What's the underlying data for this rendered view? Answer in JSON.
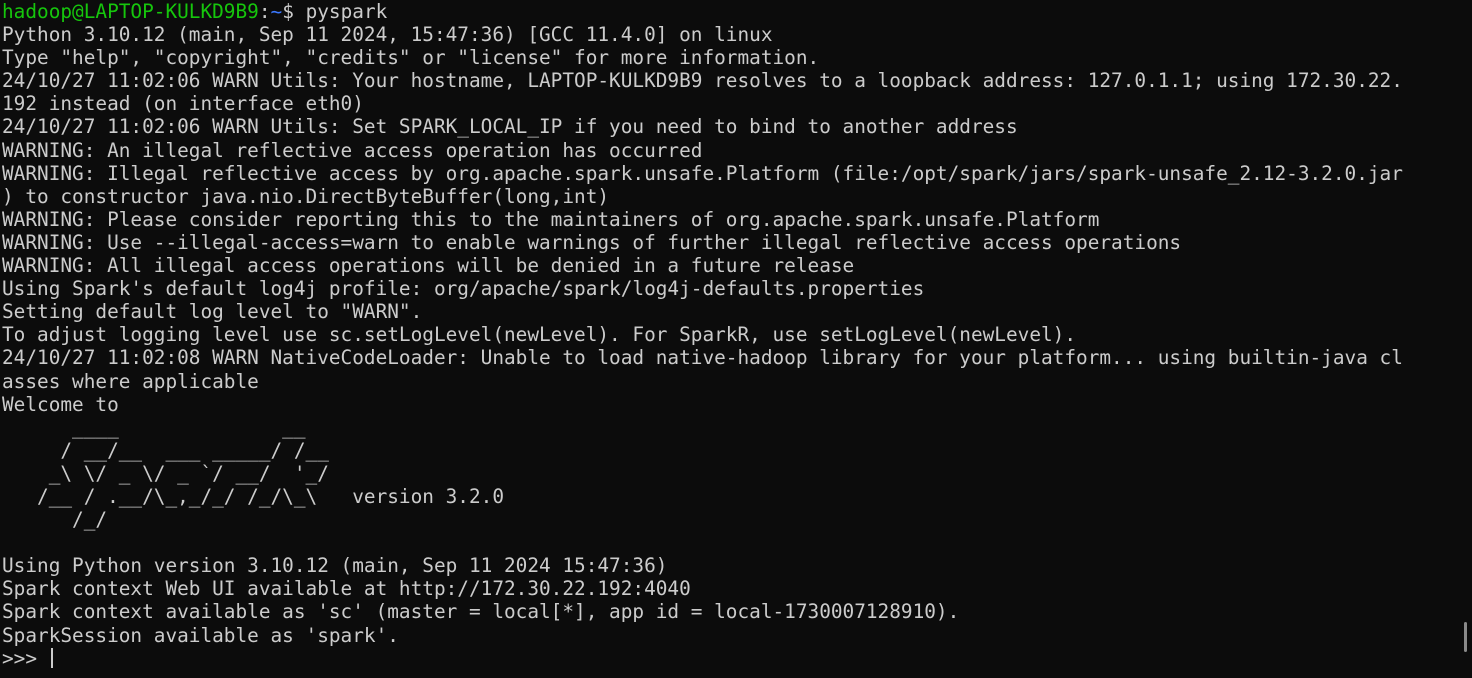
{
  "prompt": {
    "user_host": "hadoop@LAPTOP-KULKD9B9",
    "separator": ":",
    "path": "~",
    "symbol": "$ ",
    "command": "pyspark"
  },
  "output_lines": [
    "Python 3.10.12 (main, Sep 11 2024, 15:47:36) [GCC 11.4.0] on linux",
    "Type \"help\", \"copyright\", \"credits\" or \"license\" for more information.",
    "24/10/27 11:02:06 WARN Utils: Your hostname, LAPTOP-KULKD9B9 resolves to a loopback address: 127.0.1.1; using 172.30.22.",
    "192 instead (on interface eth0)",
    "24/10/27 11:02:06 WARN Utils: Set SPARK_LOCAL_IP if you need to bind to another address",
    "WARNING: An illegal reflective access operation has occurred",
    "WARNING: Illegal reflective access by org.apache.spark.unsafe.Platform (file:/opt/spark/jars/spark-unsafe_2.12-3.2.0.jar",
    ") to constructor java.nio.DirectByteBuffer(long,int)",
    "WARNING: Please consider reporting this to the maintainers of org.apache.spark.unsafe.Platform",
    "WARNING: Use --illegal-access=warn to enable warnings of further illegal reflective access operations",
    "WARNING: All illegal access operations will be denied in a future release",
    "Using Spark's default log4j profile: org/apache/spark/log4j-defaults.properties",
    "Setting default log level to \"WARN\".",
    "To adjust logging level use sc.setLogLevel(newLevel). For SparkR, use setLogLevel(newLevel).",
    "24/10/27 11:02:08 WARN NativeCodeLoader: Unable to load native-hadoop library for your platform... using builtin-java cl",
    "asses where applicable",
    "Welcome to",
    "      ____              __",
    "     / __/__  ___ _____/ /__",
    "    _\\ \\/ _ \\/ _ `/ __/  '_/",
    "   /__ / .__/\\_,_/_/ /_/\\_\\   version 3.2.0",
    "      /_/",
    "",
    "Using Python version 3.10.12 (main, Sep 11 2024 15:47:36)",
    "Spark context Web UI available at http://172.30.22.192:4040",
    "Spark context available as 'sc' (master = local[*], app id = local-1730007128910).",
    "SparkSession available as 'spark'."
  ],
  "repl_prompt": ">>> "
}
